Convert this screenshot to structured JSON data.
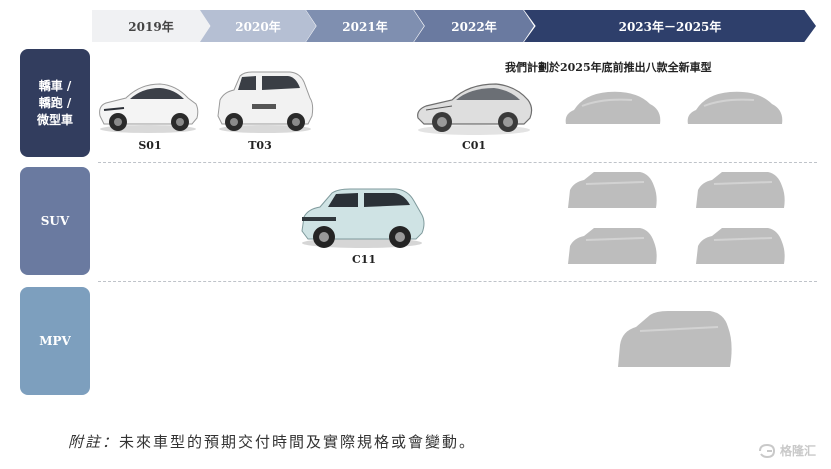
{
  "timeline": {
    "stages": [
      "2019年",
      "2020年",
      "2021年",
      "2022年",
      "2023年－2025年"
    ],
    "colors": [
      "#f0f1f3",
      "#b5bfd3",
      "#7f8fb0",
      "#6a7aa0",
      "#2e3f6b"
    ],
    "text_colors": [
      "#444444",
      "#ffffff",
      "#ffffff",
      "#ffffff",
      "#ffffff"
    ]
  },
  "rows": [
    {
      "label": "轎車 /\n轎跑 /\n微型車",
      "color": "#323d5e"
    },
    {
      "label": "SUV",
      "color": "#6a7aa0"
    },
    {
      "label": "MPV",
      "color": "#7d9fbe"
    }
  ],
  "plan_note": "我們計劃於2025年底前推出八款全新車型",
  "models": [
    {
      "name": "S01",
      "row": "sedan",
      "style": "sedan-white"
    },
    {
      "name": "T03",
      "row": "sedan",
      "style": "micro-white"
    },
    {
      "name": "C01",
      "row": "sedan",
      "style": "coupe-sketch"
    },
    {
      "name": "C11",
      "row": "suv",
      "style": "suv-lightblue"
    }
  ],
  "future_models": {
    "sedan_count": 2,
    "suv_count": 4,
    "mpv_count": 1
  },
  "footnote": {
    "label": "附註：",
    "text": "未來車型的預期交付時間及實際規格或會變動。"
  },
  "watermark": {
    "icon": "gelonghui-logo-icon",
    "text": "格隆汇"
  }
}
